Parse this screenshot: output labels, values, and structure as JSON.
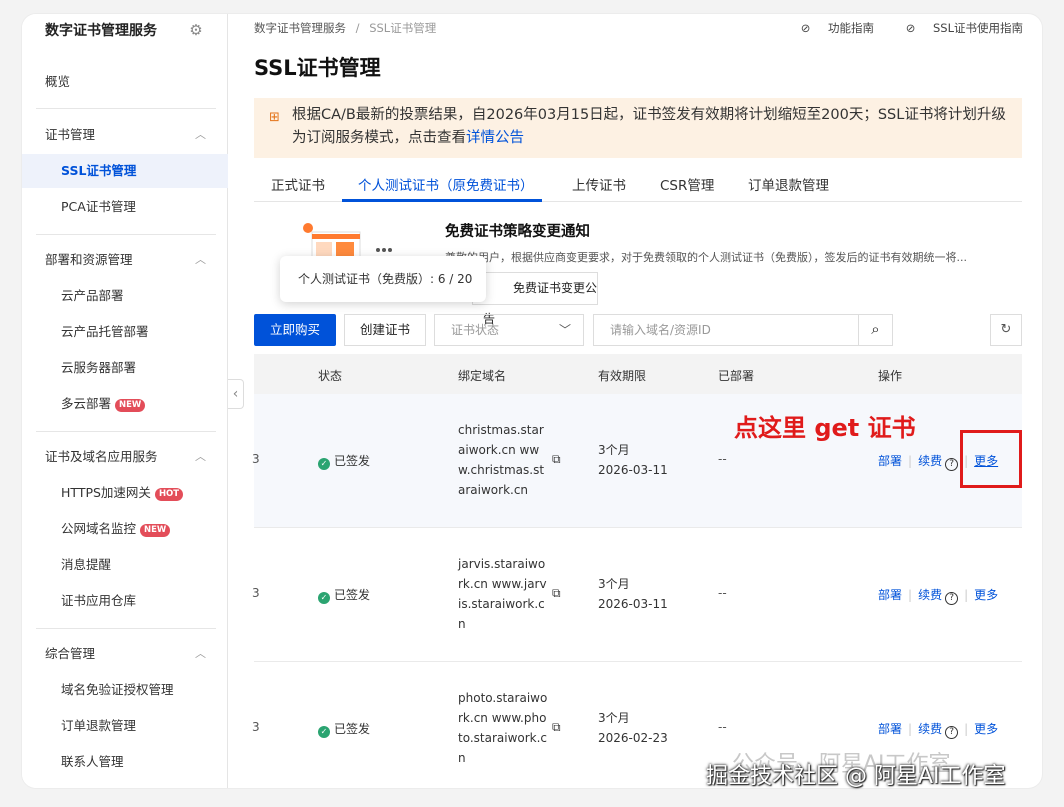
{
  "sidebar": {
    "title": "数字证书管理服务",
    "gear_icon": "gear-icon",
    "overview": "概览",
    "groups": [
      {
        "label": "证书管理",
        "items": [
          "SSL证书管理",
          "PCA证书管理"
        ]
      },
      {
        "label": "部署和资源管理",
        "items": [
          "云产品部署",
          "云产品托管部署",
          "云服务器部署",
          "多云部署"
        ]
      },
      {
        "label": "证书及域名应用服务",
        "items": [
          "HTTPS加速网关",
          "公网域名监控",
          "消息提醒",
          "证书应用仓库"
        ]
      },
      {
        "label": "综合管理",
        "items": [
          "域名免验证授权管理",
          "订单退款管理",
          "联系人管理"
        ]
      }
    ],
    "badges": {
      "new": "NEW",
      "hot": "HOT"
    }
  },
  "header": {
    "breadcrumb": [
      "数字证书管理服务",
      "/",
      "SSL证书管理"
    ],
    "links": [
      "功能指南",
      "SSL证书使用指南"
    ],
    "title": "SSL证书管理"
  },
  "notice": {
    "text": "根据CA/B最新的投票结果，自2026年03月15日起，证书签发有效期将计划缩短至200天；SSL证书将计划升级为订阅服务模式，点击查看",
    "link": "详情公告"
  },
  "tabs": [
    "正式证书",
    "个人测试证书（原免费证书）",
    "上传证书",
    "CSR管理",
    "订单退款管理"
  ],
  "promo": {
    "title": "免费证书策略变更通知",
    "text": "尊敬的用户，根据供应商变更要求，对于免费领取的个人测试证书（免费版），签发后的证书有效期统一将...",
    "button": "免费证书变更公告",
    "tooltip": "个人测试证书（免费版）:  6 / 20"
  },
  "toolbar": {
    "buy": "立即购买",
    "create": "创建证书",
    "status_placeholder": "证书状态",
    "search_placeholder": "请输入域名/资源ID"
  },
  "table": {
    "headers": [
      "状态",
      "绑定域名",
      "有效期限",
      "已部署",
      "操作"
    ],
    "rows": [
      {
        "stub": "3",
        "status": "已签发",
        "domain": "christmas.staraiwork.cn www.christmas.staraiwork.cn",
        "period": "3个月",
        "date": "2026-03-11",
        "deployed": "--"
      },
      {
        "stub": "3",
        "status": "已签发",
        "domain": "jarvis.staraiwork.cn www.jarvis.staraiwork.cn",
        "period": "3个月",
        "date": "2026-03-11",
        "deployed": "--"
      },
      {
        "stub": "3",
        "status": "已签发",
        "domain": "photo.staraiwork.cn www.photo.staraiwork.cn",
        "period": "3个月",
        "date": "2026-02-23",
        "deployed": "--"
      }
    ],
    "actions": [
      "部署",
      "续费",
      "更多"
    ]
  },
  "annotation": "点这里 get 证书",
  "watermark": {
    "faint": "公众号 · 阿星AI工作室",
    "main": "掘金技术社区 @ 阿星AI工作室"
  }
}
